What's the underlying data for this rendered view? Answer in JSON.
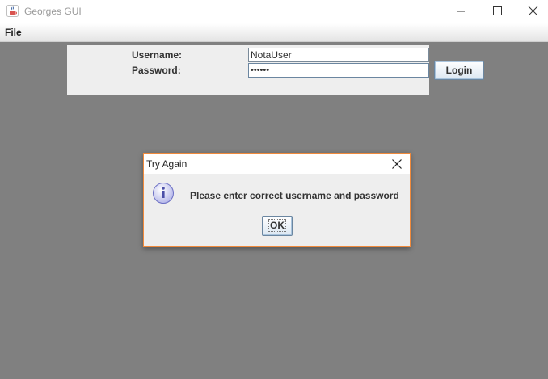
{
  "window": {
    "title": "Georges GUI",
    "icon": "java-coffee-cup-icon"
  },
  "menu": {
    "file_label": "File"
  },
  "login_form": {
    "username_label": "Username:",
    "password_label": "Password:",
    "username_value": "NotaUser",
    "password_masked": "••••••",
    "login_button_label": "Login"
  },
  "dialog": {
    "title": "Try Again",
    "icon": "info-icon",
    "message": "Please enter correct username and password",
    "ok_label": "OK"
  },
  "colors": {
    "desktop_background": "#808080",
    "dialog_border_focus": "#f08a3c",
    "panel_background": "#eeeeee"
  }
}
